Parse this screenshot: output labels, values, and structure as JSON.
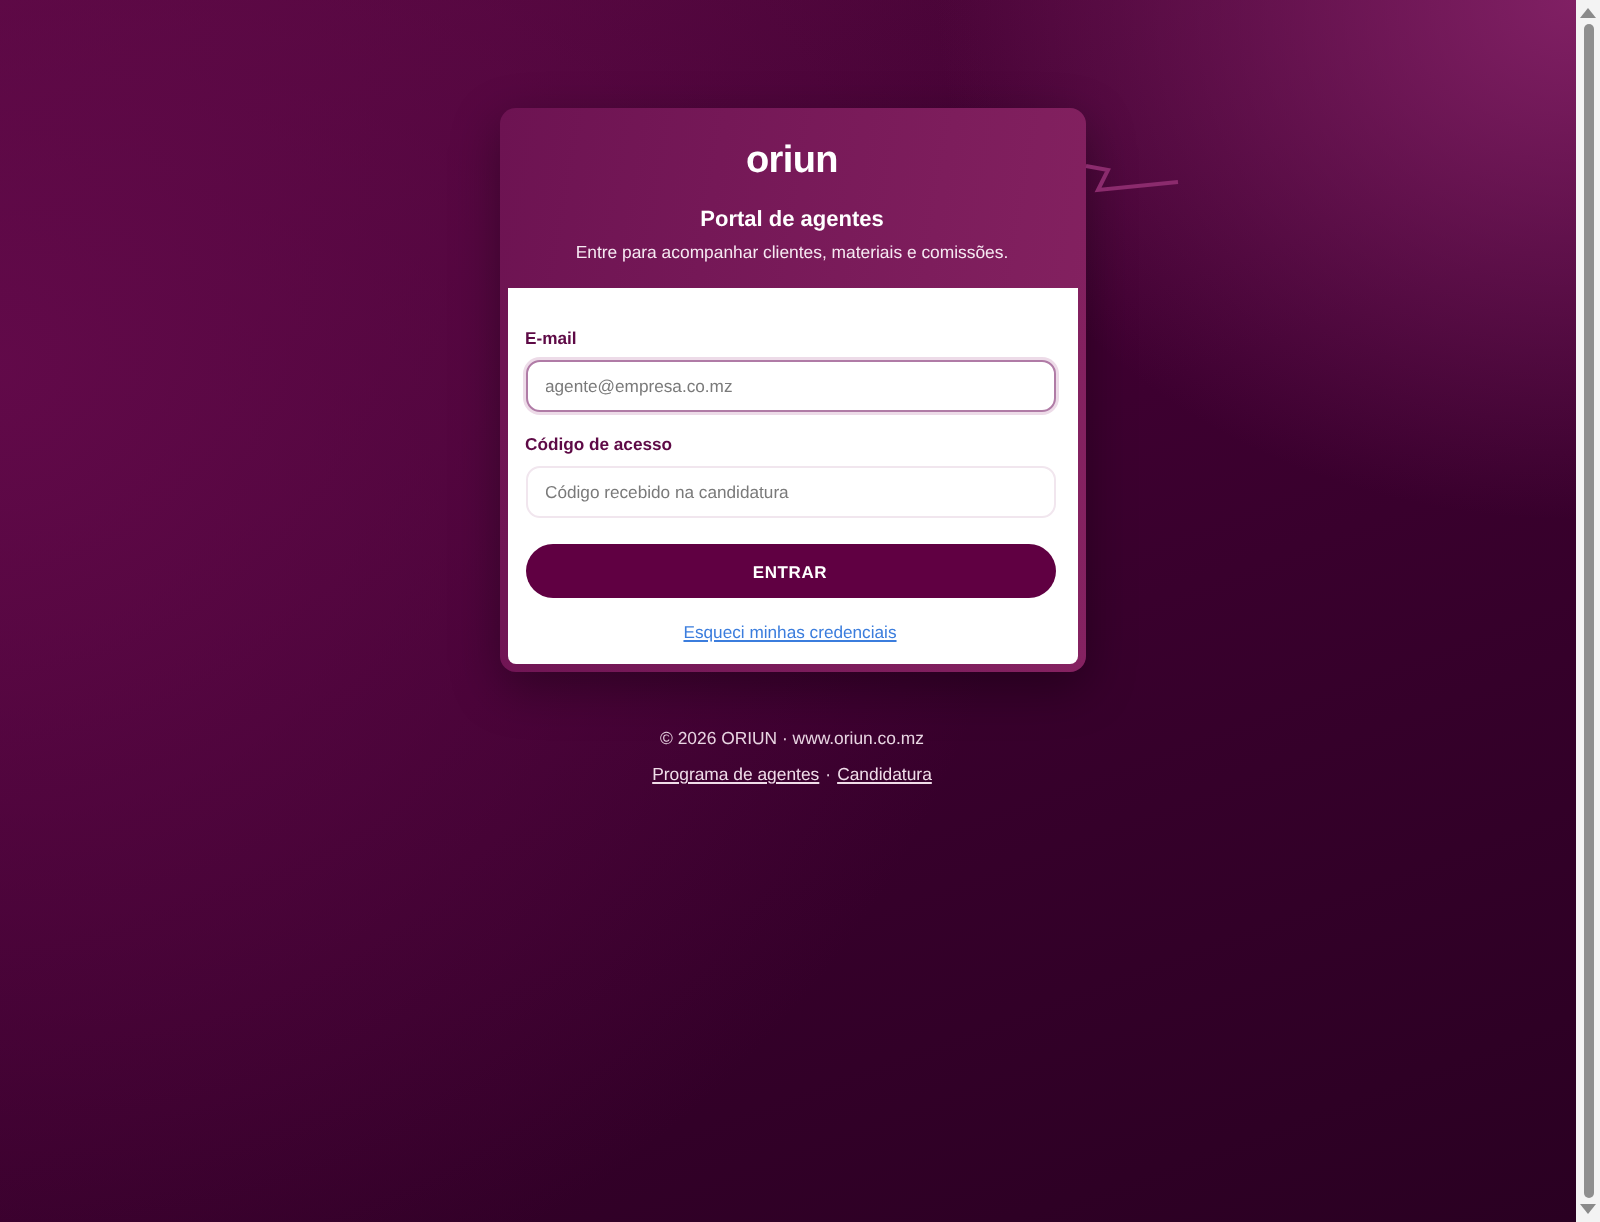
{
  "logo": "oriun",
  "header": {
    "title": "Portal de agentes",
    "subtitle": "Entre para acompanhar clientes, materiais e comissões."
  },
  "form": {
    "fields": [
      {
        "label": "E-mail",
        "placeholder": "agente@empresa.co.mz",
        "focused": true
      },
      {
        "label": "Código de acesso",
        "placeholder": "Código recebido na candidatura",
        "focused": false
      }
    ],
    "submit": "ENTRAR",
    "forgot_link": "Esqueci minhas credenciais"
  },
  "footer": {
    "copyright": "© 2026 ORIUN · www.oriun.co.mz",
    "links": [
      "Programa de agentes",
      "Candidatura"
    ],
    "separator": "·"
  }
}
